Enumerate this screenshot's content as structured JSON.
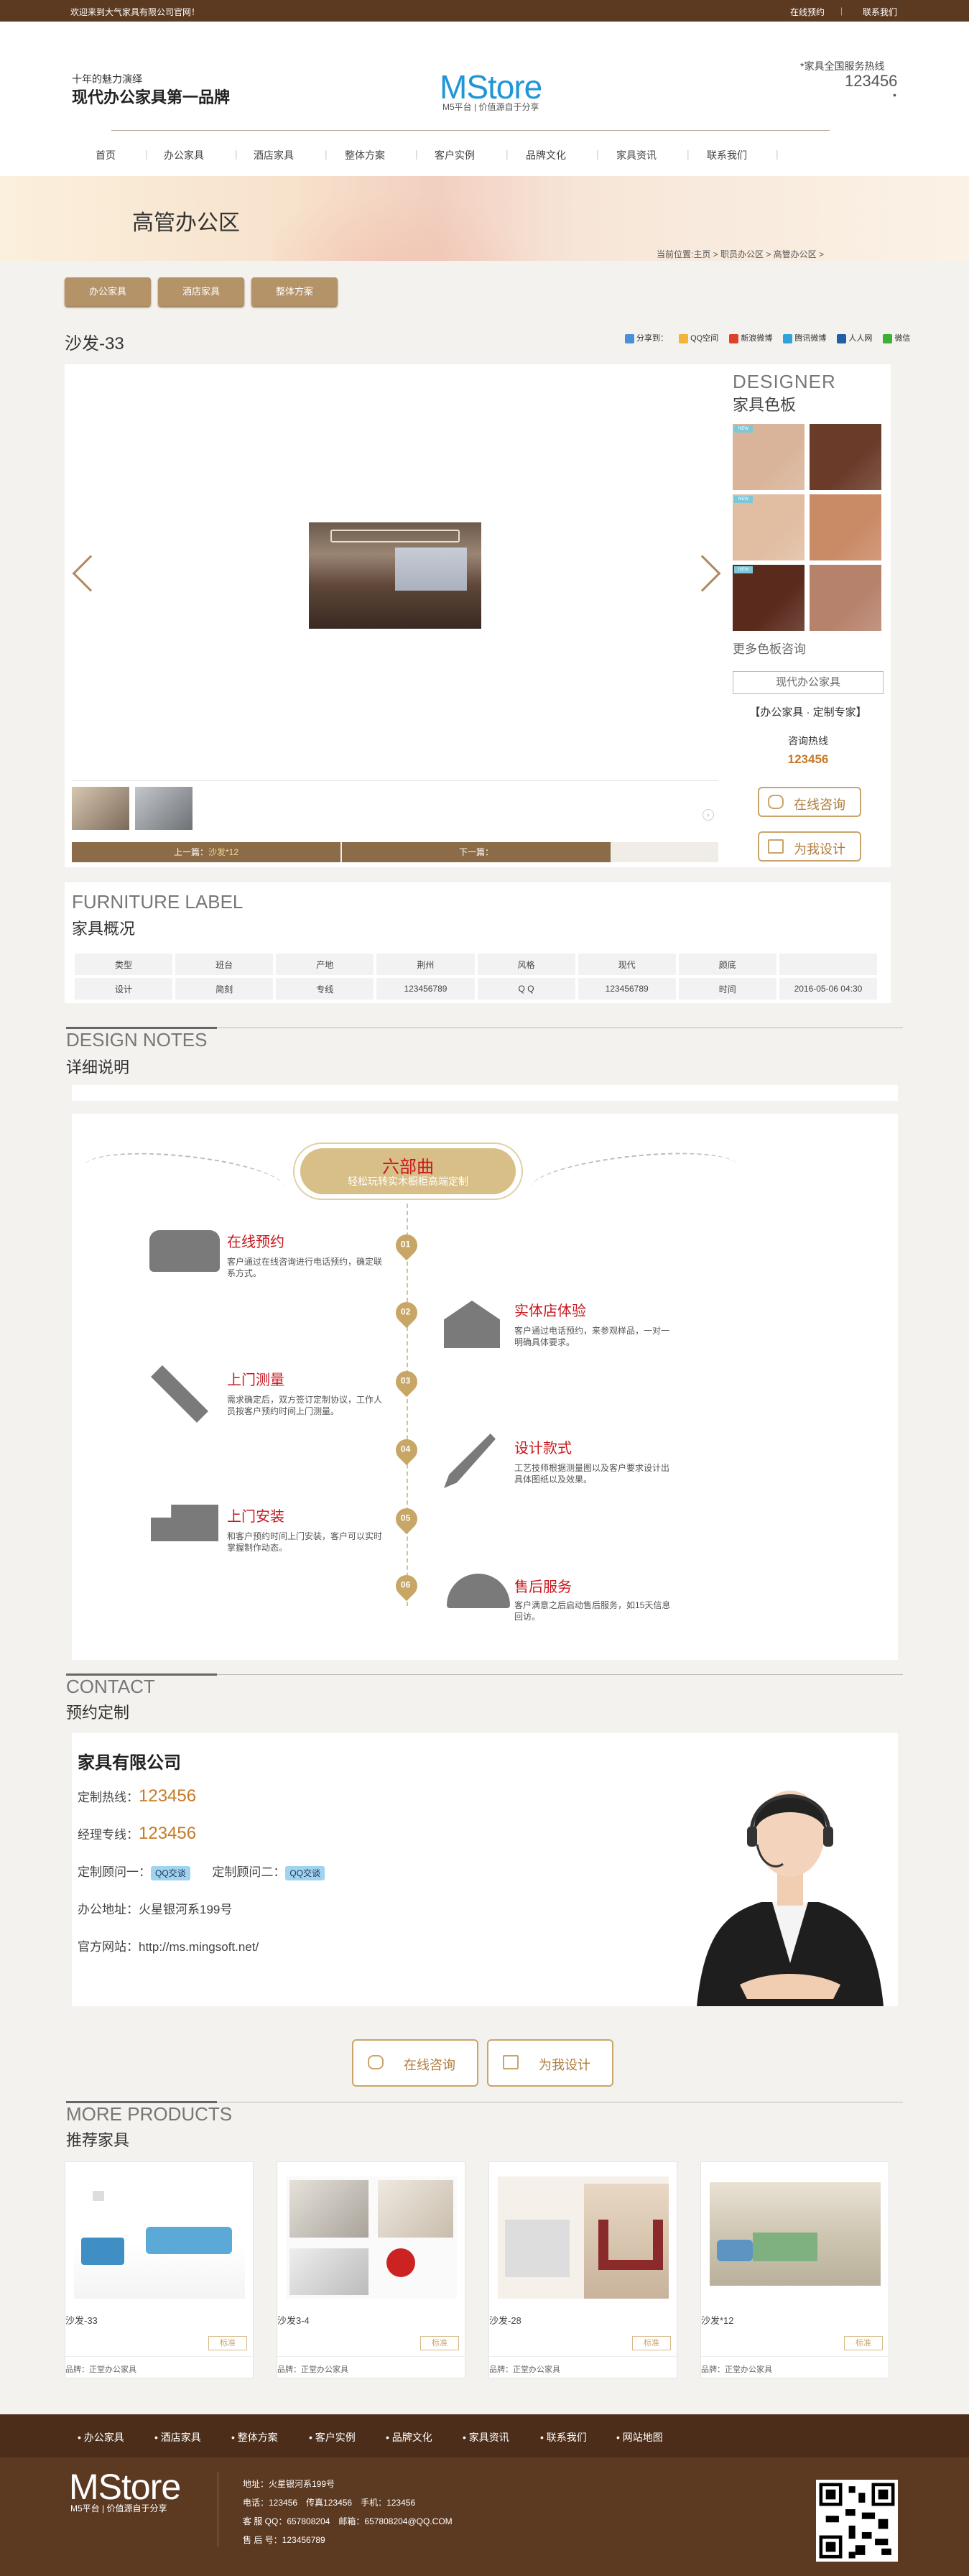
{
  "topbar": {
    "welcome": "欢迎来到大气家具有限公司官网！",
    "links": [
      "在线预约",
      "联系我们"
    ]
  },
  "header": {
    "slogan_small": "十年的魅力演绎",
    "slogan_big": "现代办公家具第一品牌",
    "logo": "MStore",
    "logo_sub": "M5平台 | 价值源自于分享",
    "hotline_label": "*家具全国服务热线",
    "hotline": "123456",
    "hotline_dot": "•"
  },
  "nav": [
    "首页",
    "办公家具",
    "酒店家具",
    "整体方案",
    "客户实例",
    "品牌文化",
    "家具资讯",
    "联系我们"
  ],
  "banner": {
    "title": "高管办公区",
    "breadcrumb": "当前位置:主页 > 职员办公区 > 高管办公区 >"
  },
  "categories": [
    "办公家具",
    "酒店家具",
    "整体方案"
  ],
  "product": {
    "title": "沙发-33",
    "share_label": "分享到：",
    "share": [
      "QQ空间",
      "新浪微博",
      "腾讯微博",
      "人人网",
      "微信"
    ],
    "prev": "上一篇：",
    "prev_link": "沙发*12",
    "next": "下一篇："
  },
  "designer": {
    "title": "DESIGNER",
    "subtitle": "家具色板",
    "swatch_tags": [
      "NEW",
      "NEW",
      "NEW"
    ],
    "swatch_colors": [
      "#d9b49a",
      "#6b3b2a",
      "#e1bda2",
      "#c98a66",
      "#5a2a1c",
      "#b7826c"
    ],
    "more": "更多色板咨询",
    "modern_button": "现代办公家具",
    "expert": "【办公家具 · 定制专家】",
    "consult_label": "咨询热线",
    "consult_number": "123456",
    "online_button": "在线咨询",
    "design_button": "为我设计"
  },
  "label": {
    "title": "FURNITURE LABEL",
    "subtitle": "家具概况",
    "rows": [
      [
        "类型",
        "班台",
        "产地",
        "荆州",
        "风格",
        "现代",
        "颜底",
        ""
      ],
      [
        "设计",
        "简刻",
        "专线",
        "123456789",
        "Q Q",
        "123456789",
        "时间",
        "2016-05-06 04:30"
      ]
    ]
  },
  "notes": {
    "title": "DESIGN NOTES",
    "subtitle": "详细说明",
    "pill_title": "六部曲",
    "pill_sub": "轻松玩转实木橱柜高端定制",
    "steps": [
      {
        "num": "01",
        "title": "在线预约",
        "desc": "客户通过在线咨询进行电话预约，确定联系方式。",
        "icon": "telephone-icon"
      },
      {
        "num": "02",
        "title": "实体店体验",
        "desc": "客户通过电话预约，来参观样品，一对一明确具体要求。",
        "icon": "store-icon"
      },
      {
        "num": "03",
        "title": "上门测量",
        "desc": "需求确定后，双方签订定制协议，工作人员按客户预约时间上门测量。",
        "icon": "measure-tools-icon"
      },
      {
        "num": "04",
        "title": "设计款式",
        "desc": "工艺技师根据测量图以及客户要求设计出具体图纸以及效果。",
        "icon": "design-pen-icon"
      },
      {
        "num": "05",
        "title": "上门安装",
        "desc": "和客户预约时间上门安装，客户可以实时掌握制作动态。",
        "icon": "delivery-truck-icon"
      },
      {
        "num": "06",
        "title": "售后服务",
        "desc": "客户满意之后启动售后服务，如15天信息回访。",
        "icon": "team-service-icon"
      }
    ]
  },
  "contact": {
    "title": "CONTACT",
    "subtitle": "预约定制",
    "company": "家具有限公司",
    "hotline_label": "定制热线：",
    "hotline": "123456",
    "manager_label": "经理专线：",
    "manager": "123456",
    "consultant1": "定制顾问一：",
    "consultant2": "定制顾问二：",
    "qq_badge": "QQ交谈",
    "address": "办公地址：火星银河系199号",
    "website": "官方网站：http://ms.mingsoft.net/",
    "online_button": "在线咨询",
    "design_button": "为我设计"
  },
  "more": {
    "title": "MORE PRODUCTS",
    "subtitle": "推荐家具",
    "items": [
      {
        "name": "沙发-33",
        "tag": "标准",
        "brand": "品牌：正堂办公家具"
      },
      {
        "name": "沙发3-4",
        "tag": "标准",
        "brand": "品牌：正堂办公家具"
      },
      {
        "name": "沙发-28",
        "tag": "标准",
        "brand": "品牌：正堂办公家具"
      },
      {
        "name": "沙发*12",
        "tag": "标准",
        "brand": "品牌：正堂办公家具"
      }
    ]
  },
  "footer": {
    "nav": [
      "办公家具",
      "酒店家具",
      "整体方案",
      "客户实例",
      "品牌文化",
      "家具资讯",
      "联系我们",
      "网站地图"
    ],
    "logo": "MStore",
    "logo_sub": "M5平台 | 价值源自于分享",
    "address": "地址：火星银河系199号",
    "phone": "电话：123456　传真123456　手机：123456",
    "qq": "客 服 QQ：657808204　邮箱：657808204@QQ.COM",
    "service": "售 后 号：123456789"
  }
}
